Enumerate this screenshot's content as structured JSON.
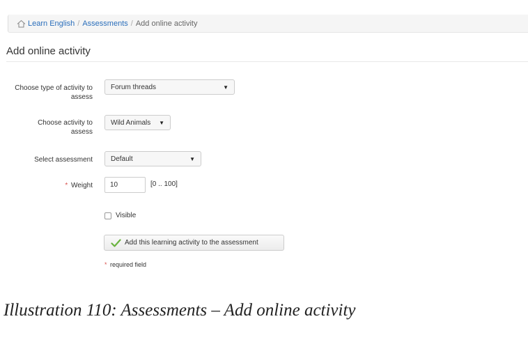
{
  "breadcrumb": {
    "items": [
      "Learn English",
      "Assessments"
    ],
    "separator": "/",
    "current": "Add online activity",
    "home_icon": "home-icon"
  },
  "page_title": "Add online activity",
  "form": {
    "activity_type": {
      "label": "Choose type of activity to assess",
      "value": "Forum threads"
    },
    "activity": {
      "label": "Choose activity to assess",
      "value": "Wild Animals"
    },
    "assessment": {
      "label": "Select assessment",
      "value": "Default"
    },
    "weight": {
      "label": "Weight",
      "value": "10",
      "range": "[0 .. 100]",
      "required_mark": "*"
    },
    "visible": {
      "label": "Visible",
      "checked": false
    },
    "submit": {
      "label": "Add this learning activity to the assessment",
      "icon": "check-icon"
    },
    "required_note": {
      "mark": "*",
      "text": "required field"
    }
  },
  "caption": "Illustration 110: Assessments – Add online activity",
  "colors": {
    "link": "#2a6ebb",
    "required": "#d9534f",
    "check": "#6ab33e"
  }
}
